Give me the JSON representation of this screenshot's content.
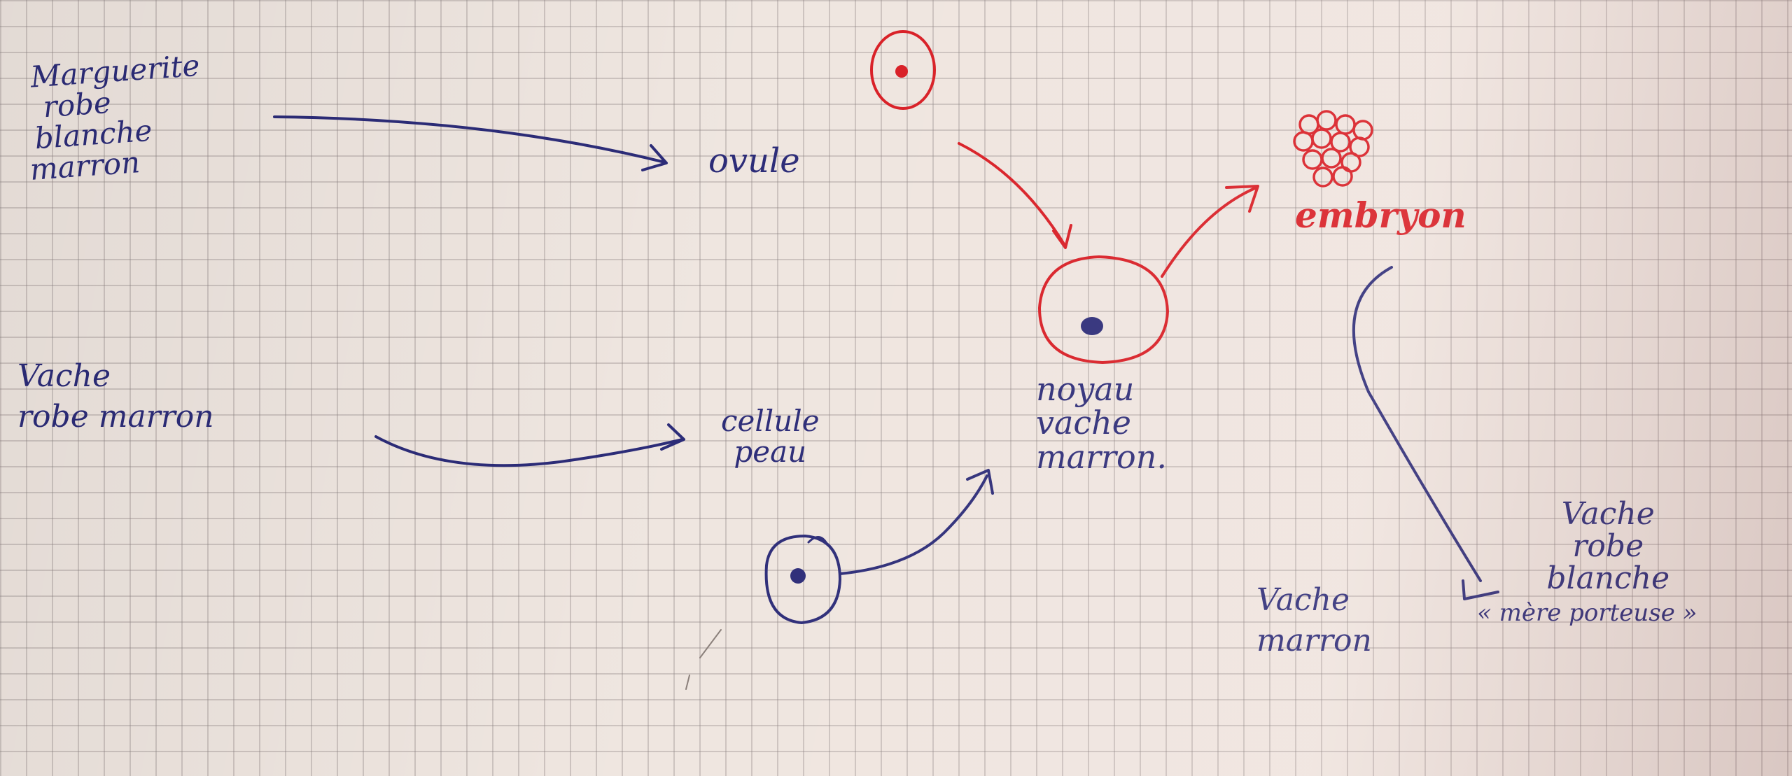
{
  "colors": {
    "blue_ink": "#2c2c78",
    "red_ink": "#d81d24",
    "paper": "#efe6e0"
  },
  "donor_white": {
    "lines": [
      "Marguerite",
      "robe",
      "blanche",
      "marron"
    ]
  },
  "donor_brown": {
    "lines": [
      "Vache",
      "robe marron"
    ]
  },
  "ovule_label": "ovule",
  "skin_cell_label": {
    "lines": [
      "cellule",
      "peau"
    ]
  },
  "nucleus_label": {
    "lines": [
      "noyau",
      "vache",
      "marron."
    ]
  },
  "embryo_label": "embryon",
  "result_label": {
    "lines": [
      "Vache",
      "marron"
    ]
  },
  "surrogate_label": {
    "lines": [
      "Vache",
      "robe",
      "blanche",
      "« mère porteuse »"
    ]
  }
}
